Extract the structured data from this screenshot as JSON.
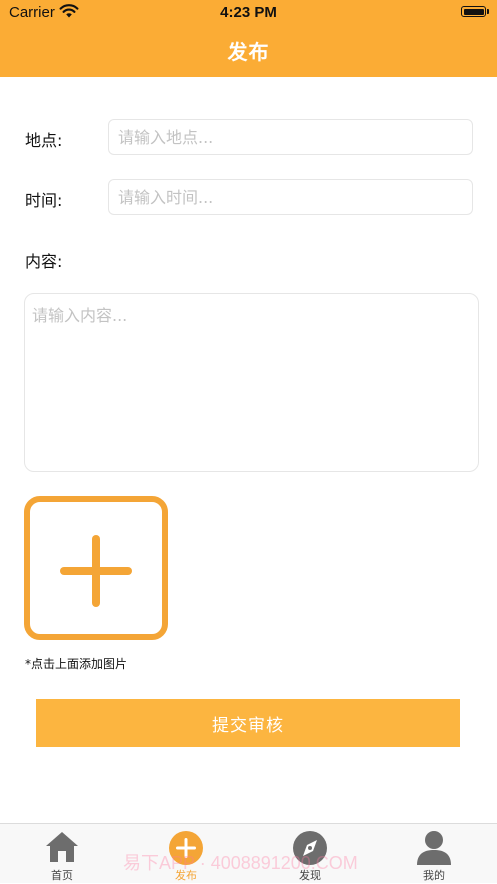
{
  "status_bar": {
    "carrier": "Carrier",
    "time": "4:23 PM",
    "wifi_icon": "wifi-icon",
    "battery_icon": "battery-icon"
  },
  "nav": {
    "title": "发布"
  },
  "form": {
    "location_label": "地点:",
    "location_placeholder": "请输入地点...",
    "location_value": "",
    "time_label": "时间:",
    "time_placeholder": "请输入时间...",
    "time_value": "",
    "content_label": "内容:",
    "content_placeholder": "请输入内容...",
    "content_value": "",
    "add_image_icon": "plus-icon",
    "add_image_hint": "*点击上面添加图片",
    "submit_label": "提交审核"
  },
  "tabbar": {
    "tabs": [
      {
        "label": "首页",
        "icon": "home-icon",
        "active": false
      },
      {
        "label": "发布",
        "icon": "plus-circle-icon",
        "active": true
      },
      {
        "label": "发现",
        "icon": "compass-icon",
        "active": false
      },
      {
        "label": "我的",
        "icon": "user-icon",
        "active": false
      }
    ]
  },
  "watermark": "易下APP · 4008891200.COM",
  "colors": {
    "accent": "#fbac35",
    "button": "#fcb540",
    "add_image_border": "#f4a536",
    "tab_inactive_icon": "#6d6d6d",
    "tab_active_label": "#f4a536"
  }
}
